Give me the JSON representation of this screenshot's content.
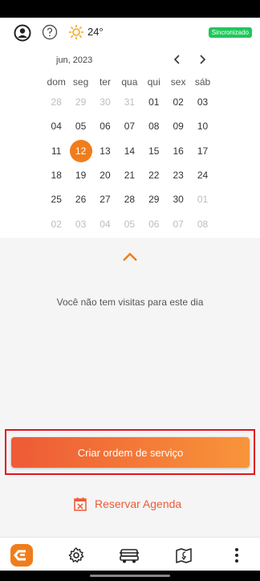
{
  "header": {
    "temperature": "24°",
    "sync_status": "Sincronizado",
    "icons": {
      "profile": "user-circle-icon",
      "help": "help-circle-icon",
      "weather": "sun-icon"
    }
  },
  "calendar": {
    "month_label": "jun, 2023",
    "weekdays": [
      "dom",
      "seg",
      "ter",
      "qua",
      "qui",
      "sex",
      "sáb"
    ],
    "weeks": [
      [
        {
          "d": "28",
          "m": true
        },
        {
          "d": "29",
          "m": true
        },
        {
          "d": "30",
          "m": true
        },
        {
          "d": "31",
          "m": true
        },
        {
          "d": "01"
        },
        {
          "d": "02"
        },
        {
          "d": "03"
        }
      ],
      [
        {
          "d": "04"
        },
        {
          "d": "05"
        },
        {
          "d": "06"
        },
        {
          "d": "07"
        },
        {
          "d": "08"
        },
        {
          "d": "09"
        },
        {
          "d": "10"
        }
      ],
      [
        {
          "d": "11"
        },
        {
          "d": "12",
          "s": true
        },
        {
          "d": "13"
        },
        {
          "d": "14"
        },
        {
          "d": "15"
        },
        {
          "d": "16"
        },
        {
          "d": "17"
        }
      ],
      [
        {
          "d": "18"
        },
        {
          "d": "19"
        },
        {
          "d": "20"
        },
        {
          "d": "21"
        },
        {
          "d": "22"
        },
        {
          "d": "23"
        },
        {
          "d": "24"
        }
      ],
      [
        {
          "d": "25"
        },
        {
          "d": "26"
        },
        {
          "d": "27"
        },
        {
          "d": "28"
        },
        {
          "d": "29"
        },
        {
          "d": "30"
        },
        {
          "d": "01",
          "m": true
        }
      ],
      [
        {
          "d": "02",
          "m": true
        },
        {
          "d": "03",
          "m": true
        },
        {
          "d": "04",
          "m": true
        },
        {
          "d": "05",
          "m": true
        },
        {
          "d": "06",
          "m": true
        },
        {
          "d": "07",
          "m": true
        },
        {
          "d": "08",
          "m": true
        }
      ]
    ],
    "selected_day": "12"
  },
  "main": {
    "empty_message": "Você não tem visitas para este dia",
    "create_button_label": "Criar ordem de serviço",
    "reserve_label": "Reservar Agenda"
  },
  "bottom_nav": {
    "items": [
      "app-logo-icon",
      "settings-gear-icon",
      "vehicle-icon",
      "map-pin-icon",
      "more-vertical-icon"
    ]
  },
  "colors": {
    "accent": "#f07d1b",
    "sync_badge": "#1ec85a",
    "cta_start": "#ee5a36",
    "cta_end": "#f8953a",
    "highlight_border": "#e0141e"
  }
}
